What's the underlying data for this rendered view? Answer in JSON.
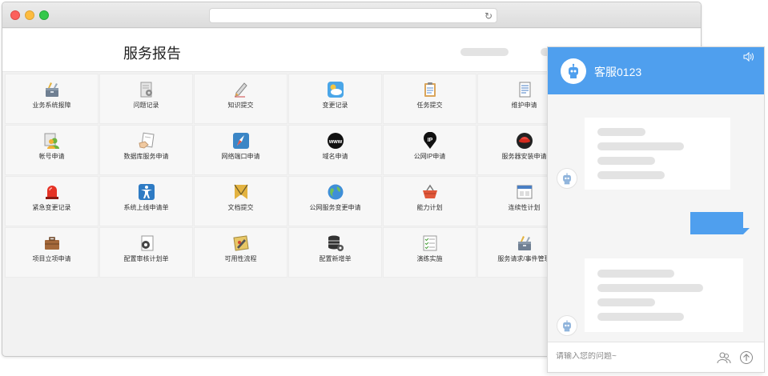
{
  "window": {
    "url": ""
  },
  "header": {
    "title": "服务报告"
  },
  "tiles": [
    {
      "label": "业务系统报障",
      "icon": "tools-box-icon"
    },
    {
      "label": "问题记录",
      "icon": "document-gear-icon"
    },
    {
      "label": "知识提交",
      "icon": "pencil-icon"
    },
    {
      "label": "变更记录",
      "icon": "weather-cloud-icon"
    },
    {
      "label": "任务提交",
      "icon": "clipboard-icon"
    },
    {
      "label": "维护申请",
      "icon": "document-list-icon"
    },
    {
      "label": "帐号申请",
      "icon": "users-icon"
    },
    {
      "label": "数据库服务申请",
      "icon": "hand-document-icon"
    },
    {
      "label": "网络端口申请",
      "icon": "compass-icon"
    },
    {
      "label": "域名申请",
      "icon": "www-icon"
    },
    {
      "label": "公网IP申请",
      "icon": "ip-pin-icon"
    },
    {
      "label": "服务器安装申请",
      "icon": "redhat-icon"
    },
    {
      "label": "紧急变更记录",
      "icon": "alarm-light-icon"
    },
    {
      "label": "系统上线申请单",
      "icon": "accessibility-icon"
    },
    {
      "label": "文档提交",
      "icon": "folder-icon"
    },
    {
      "label": "公网服务变更申请",
      "icon": "globe-icon"
    },
    {
      "label": "能力计划",
      "icon": "basket-icon"
    },
    {
      "label": "连续性计划",
      "icon": "window-calendar-icon"
    },
    {
      "label": "项目立项申请",
      "icon": "briefcase-icon"
    },
    {
      "label": "配置审核计划单",
      "icon": "gear-document-icon"
    },
    {
      "label": "可用性流程",
      "icon": "paint-doc-icon"
    },
    {
      "label": "配置新增单",
      "icon": "database-gear-icon"
    },
    {
      "label": "演练实施",
      "icon": "checklist-icon"
    },
    {
      "label": "服务请求/事件管理",
      "icon": "tools-box-icon"
    }
  ],
  "chat": {
    "agent_name": "客服0123",
    "input_placeholder": "请输入您的问题~"
  },
  "colors": {
    "accent": "#4f9fee",
    "tile_bg": "#f7f7f7",
    "skeleton": "#e3e3e3"
  }
}
